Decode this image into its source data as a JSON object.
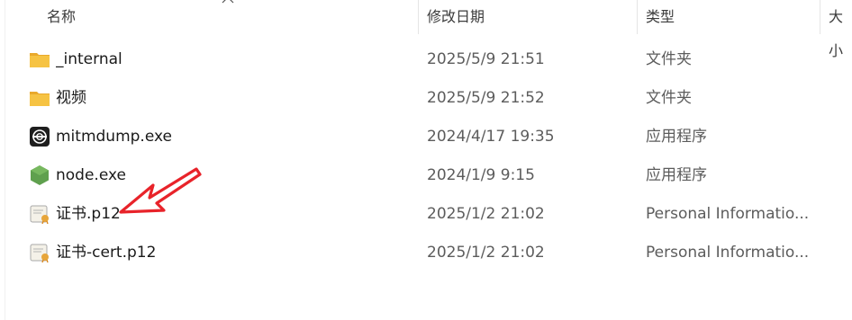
{
  "columns": {
    "name": "名称",
    "modified": "修改日期",
    "type": "类型",
    "size": "大小"
  },
  "files": [
    {
      "name": "_internal",
      "modified": "2025/5/9 21:51",
      "type": "文件夹",
      "icon": "folder-icon"
    },
    {
      "name": "视频",
      "modified": "2025/5/9 21:52",
      "type": "文件夹",
      "icon": "folder-icon"
    },
    {
      "name": "mitmdump.exe",
      "modified": "2024/4/17 19:35",
      "type": "应用程序",
      "icon": "mitmdump-app-icon"
    },
    {
      "name": "node.exe",
      "modified": "2024/1/9 9:15",
      "type": "应用程序",
      "icon": "nodejs-app-icon"
    },
    {
      "name": "证书.p12",
      "modified": "2025/1/2 21:02",
      "type": "Personal Informatio...",
      "icon": "certificate-file-icon"
    },
    {
      "name": "证书-cert.p12",
      "modified": "2025/1/2 21:02",
      "type": "Personal Informatio...",
      "icon": "certificate-file-icon"
    }
  ],
  "colors": {
    "folder": "#f6c343",
    "annotation_arrow": "#e8232a",
    "node_green": "#5fa04e"
  },
  "annotation": {
    "kind": "arrow-icon",
    "target": "证书.p12"
  }
}
